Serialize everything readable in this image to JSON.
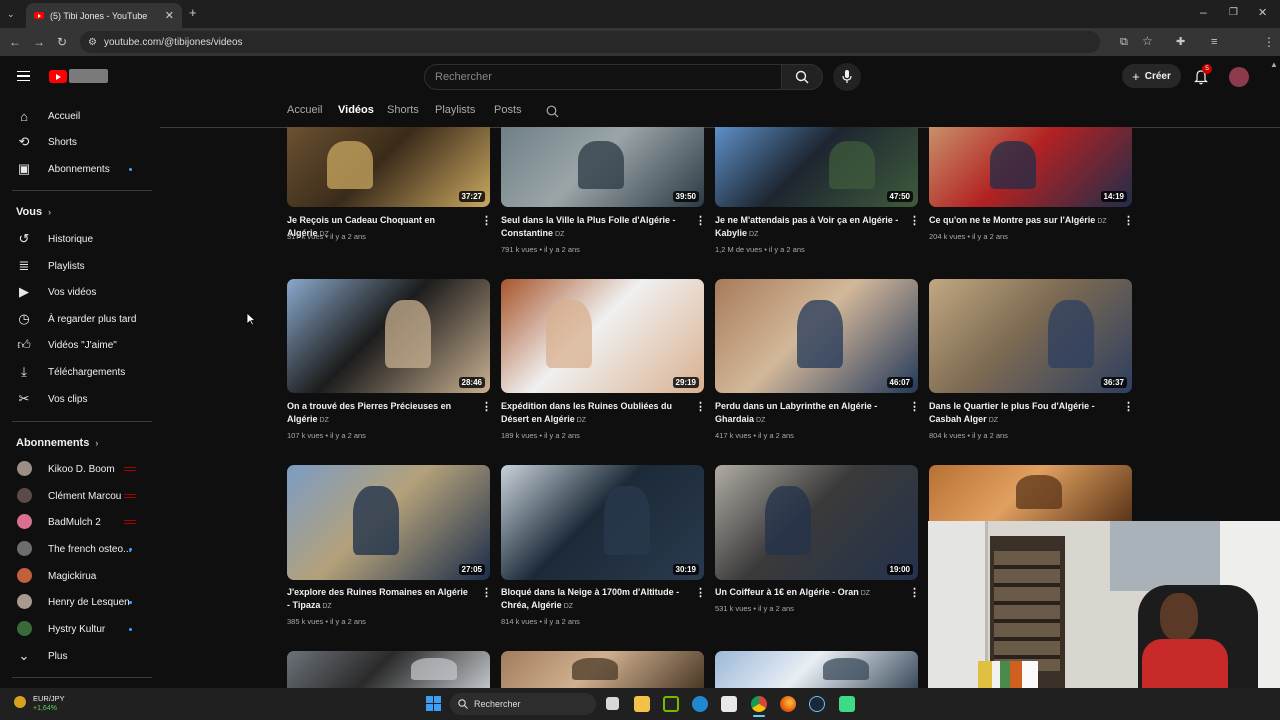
{
  "browser": {
    "tab_title": "(5) Tibi Jones - YouTube",
    "tab_close": "✕",
    "new_tab": "+",
    "url": "youtube.com/@tibijones/videos"
  },
  "masthead": {
    "search_placeholder": "Rechercher",
    "create_label": "Créer",
    "notification_count": "5"
  },
  "sidebar": {
    "main": [
      {
        "label": "Accueil",
        "icon": "home-icon"
      },
      {
        "label": "Shorts",
        "icon": "shorts-icon"
      },
      {
        "label": "Abonnements",
        "icon": "subscriptions-icon"
      }
    ],
    "you_heading": "Vous",
    "you_items": [
      {
        "label": "Historique",
        "icon": "history-icon"
      },
      {
        "label": "Playlists",
        "icon": "playlists-icon"
      },
      {
        "label": "Vos vidéos",
        "icon": "your-videos-icon"
      },
      {
        "label": "À regarder plus tard",
        "icon": "watch-later-icon"
      },
      {
        "label": "Vidéos \"J'aime\"",
        "icon": "like-icon"
      },
      {
        "label": "Téléchargements",
        "icon": "download-icon"
      },
      {
        "label": "Vos clips",
        "icon": "clips-icon"
      }
    ],
    "subs_heading": "Abonnements",
    "subs": [
      {
        "label": "Kikoo D. Boom",
        "color": "#9a8e86",
        "status": "live"
      },
      {
        "label": "Clément Marcou",
        "color": "#5b4a48",
        "status": "live"
      },
      {
        "label": "BadMulch 2",
        "color": "#d9708e",
        "status": "live"
      },
      {
        "label": "The french osteo...",
        "color": "#6d6d6d",
        "status": "new"
      },
      {
        "label": "Magickirua",
        "color": "#c0603c",
        "status": "none"
      },
      {
        "label": "Henry de Lesquen",
        "color": "#a89a8c",
        "status": "new"
      },
      {
        "label": "Hystry Kultur",
        "color": "#3a6a3a",
        "status": "new"
      }
    ],
    "more_label": "Plus"
  },
  "channel_tabs": [
    "Accueil",
    "Vidéos",
    "Shorts",
    "Playlists",
    "Posts"
  ],
  "videos": [
    {
      "title": "Je Reçois un Cadeau Choquant en Algérie",
      "dz": "DZ",
      "views": "317 k vues",
      "age": "il y a 2 ans",
      "duration": "37:27",
      "colors": [
        "#6b5230",
        "#c9a860",
        "#3a2b1a"
      ]
    },
    {
      "title": "Seul dans la Ville la Plus Folle d'Algérie - Constantine",
      "dz": "DZ",
      "views": "791 k vues",
      "age": "il y a 2 ans",
      "duration": "39:50",
      "colors": [
        "#6f7f86",
        "#2c3a44",
        "#9aa5a8"
      ]
    },
    {
      "title": "Je ne M'attendais pas à Voir ça en Algérie - Kabylie",
      "dz": "DZ",
      "views": "1,2 M de vues",
      "age": "il y a 2 ans",
      "duration": "47:50",
      "colors": [
        "#5d8fc8",
        "#3f5b3c",
        "#1d2630"
      ]
    },
    {
      "title": "Ce qu'on ne te Montre pas sur l'Algérie",
      "dz": "DZ",
      "views": "204 k vues",
      "age": "il y a 2 ans",
      "duration": "14:19",
      "colors": [
        "#c8906a",
        "#1f2d4a",
        "#b22222"
      ]
    },
    {
      "title": "On a trouvé des Pierres Précieuses en Algérie",
      "dz": "DZ",
      "views": "107 k vues",
      "age": "il y a 2 ans",
      "duration": "28:46",
      "colors": [
        "#8aa9cc",
        "#c8b090",
        "#1c1c1c"
      ]
    },
    {
      "title": "Expédition dans les Ruines Oubliées du Désert en Algérie",
      "dz": "DZ",
      "views": "189 k vues",
      "age": "il y a 2 ans",
      "duration": "29:19",
      "colors": [
        "#a8552c",
        "#d8b090",
        "#f0f0f0"
      ]
    },
    {
      "title": "Perdu dans un Labyrinthe en Algérie - Ghardaia",
      "dz": "DZ",
      "views": "417 k vues",
      "age": "il y a 2 ans",
      "duration": "46:07",
      "colors": [
        "#a87b5a",
        "#23385a",
        "#d2b89a"
      ]
    },
    {
      "title": "Dans le Quartier le plus Fou d'Algérie - Casbah Alger",
      "dz": "DZ",
      "views": "804 k vues",
      "age": "il y a 2 ans",
      "duration": "36:37",
      "colors": [
        "#c2a882",
        "#2d3f60",
        "#7d6a52"
      ]
    },
    {
      "title": "J'explore des Ruines Romaines en Algérie - Tipaza",
      "dz": "DZ",
      "views": "385 k vues",
      "age": "il y a 2 ans",
      "duration": "27:05",
      "colors": [
        "#7b9cc4",
        "#1a2d4a",
        "#b4a17a"
      ]
    },
    {
      "title": "Bloqué dans la Neige à 1700m d'Altitude - Chréa, Algérie",
      "dz": "DZ",
      "views": "814 k vues",
      "age": "il y a 2 ans",
      "duration": "30:19",
      "colors": [
        "#c8d2da",
        "#2a3a4e",
        "#1c2a38"
      ]
    },
    {
      "title": "Un Coiffeur à 1€ en Algérie - Oran",
      "dz": "DZ",
      "views": "531 k vues",
      "age": "il y a 2 ans",
      "duration": "19:00",
      "colors": [
        "#b0aca4",
        "#24324c",
        "#3a3a3a"
      ]
    },
    {
      "title": "",
      "dz": "",
      "views": "",
      "age": "",
      "duration": "",
      "colors": [
        "#b87034",
        "#5a3418",
        "#e0a060"
      ]
    },
    {
      "title": "",
      "dz": "",
      "views": "",
      "age": "",
      "duration": "",
      "colors": [
        "#6d737a",
        "#c0c4c8",
        "#2a2a2a"
      ]
    },
    {
      "title": "",
      "dz": "",
      "views": "",
      "age": "",
      "duration": "",
      "colors": [
        "#a07c5c",
        "#4a3826",
        "#d0b090"
      ]
    },
    {
      "title": "",
      "dz": "",
      "views": "",
      "age": "",
      "duration": "",
      "colors": [
        "#9cb8d8",
        "#3a4a5a",
        "#e8eef4"
      ]
    }
  ],
  "widget": {
    "symbol": "EUR/JPY",
    "change": "+1,64%"
  },
  "taskbar": {
    "search_placeholder": "Rechercher"
  }
}
